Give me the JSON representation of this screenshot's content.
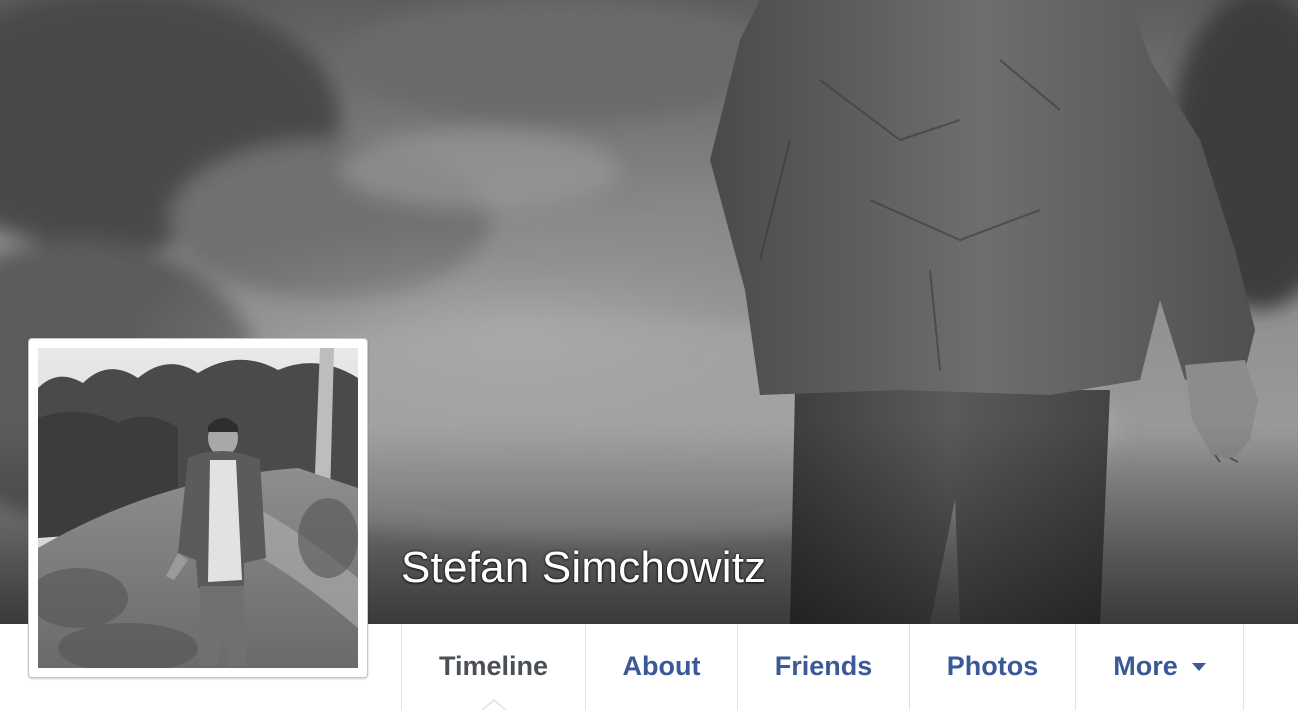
{
  "profile": {
    "name": "Stefan Simchowitz"
  },
  "tabs": [
    {
      "label": "Timeline",
      "active": true
    },
    {
      "label": "About",
      "active": false
    },
    {
      "label": "Friends",
      "active": false
    },
    {
      "label": "Photos",
      "active": false
    },
    {
      "label": "More",
      "active": false,
      "has_dropdown": true
    }
  ],
  "colors": {
    "link": "#3b5998",
    "active_tab": "#4b4f56",
    "divider": "#e1e2e5"
  }
}
